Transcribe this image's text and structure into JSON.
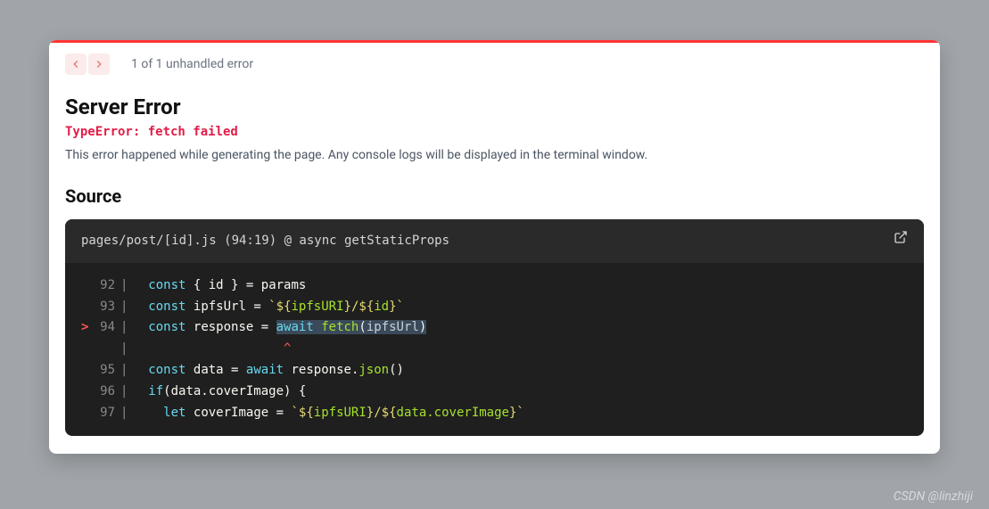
{
  "nav": {
    "counter": "1 of 1 unhandled error"
  },
  "error": {
    "title": "Server Error",
    "type": "TypeError: fetch failed",
    "description": "This error happened while generating the page. Any console logs will be displayed in the terminal window."
  },
  "source": {
    "heading": "Source",
    "location": "pages/post/[id].js (94:19) @ async getStaticProps",
    "lines": {
      "l92": "92",
      "l93": "93",
      "l94": "94",
      "l95": "95",
      "l96": "96",
      "l97": "97"
    },
    "tokens": {
      "const": "const",
      "let": "let",
      "await": "await",
      "if": "if",
      "destructId": "{ id }",
      "eq": " = ",
      "params": "params",
      "ipfsUrlVar": "ipfsUrl",
      "responseVar": "response",
      "dataVar": "data",
      "coverImageVar": "coverImage",
      "fetch": "fetch",
      "json": "json",
      "openParen": "(",
      "closeParen": ")",
      "dot": ".",
      "openBrace": " {",
      "tpl1Open": "`",
      "tpl1a": "${",
      "tpl1b": "ipfsURI",
      "tpl1c": "}",
      "tpl1Slash": "/",
      "tpl1d": "${",
      "tpl1e": "id",
      "tpl1f": "}",
      "tpl1Close": "`",
      "tpl2b": "data.coverImage",
      "coverCond": "data.coverImage",
      "caret": "^"
    }
  },
  "watermark": "CSDN @linzhiji"
}
